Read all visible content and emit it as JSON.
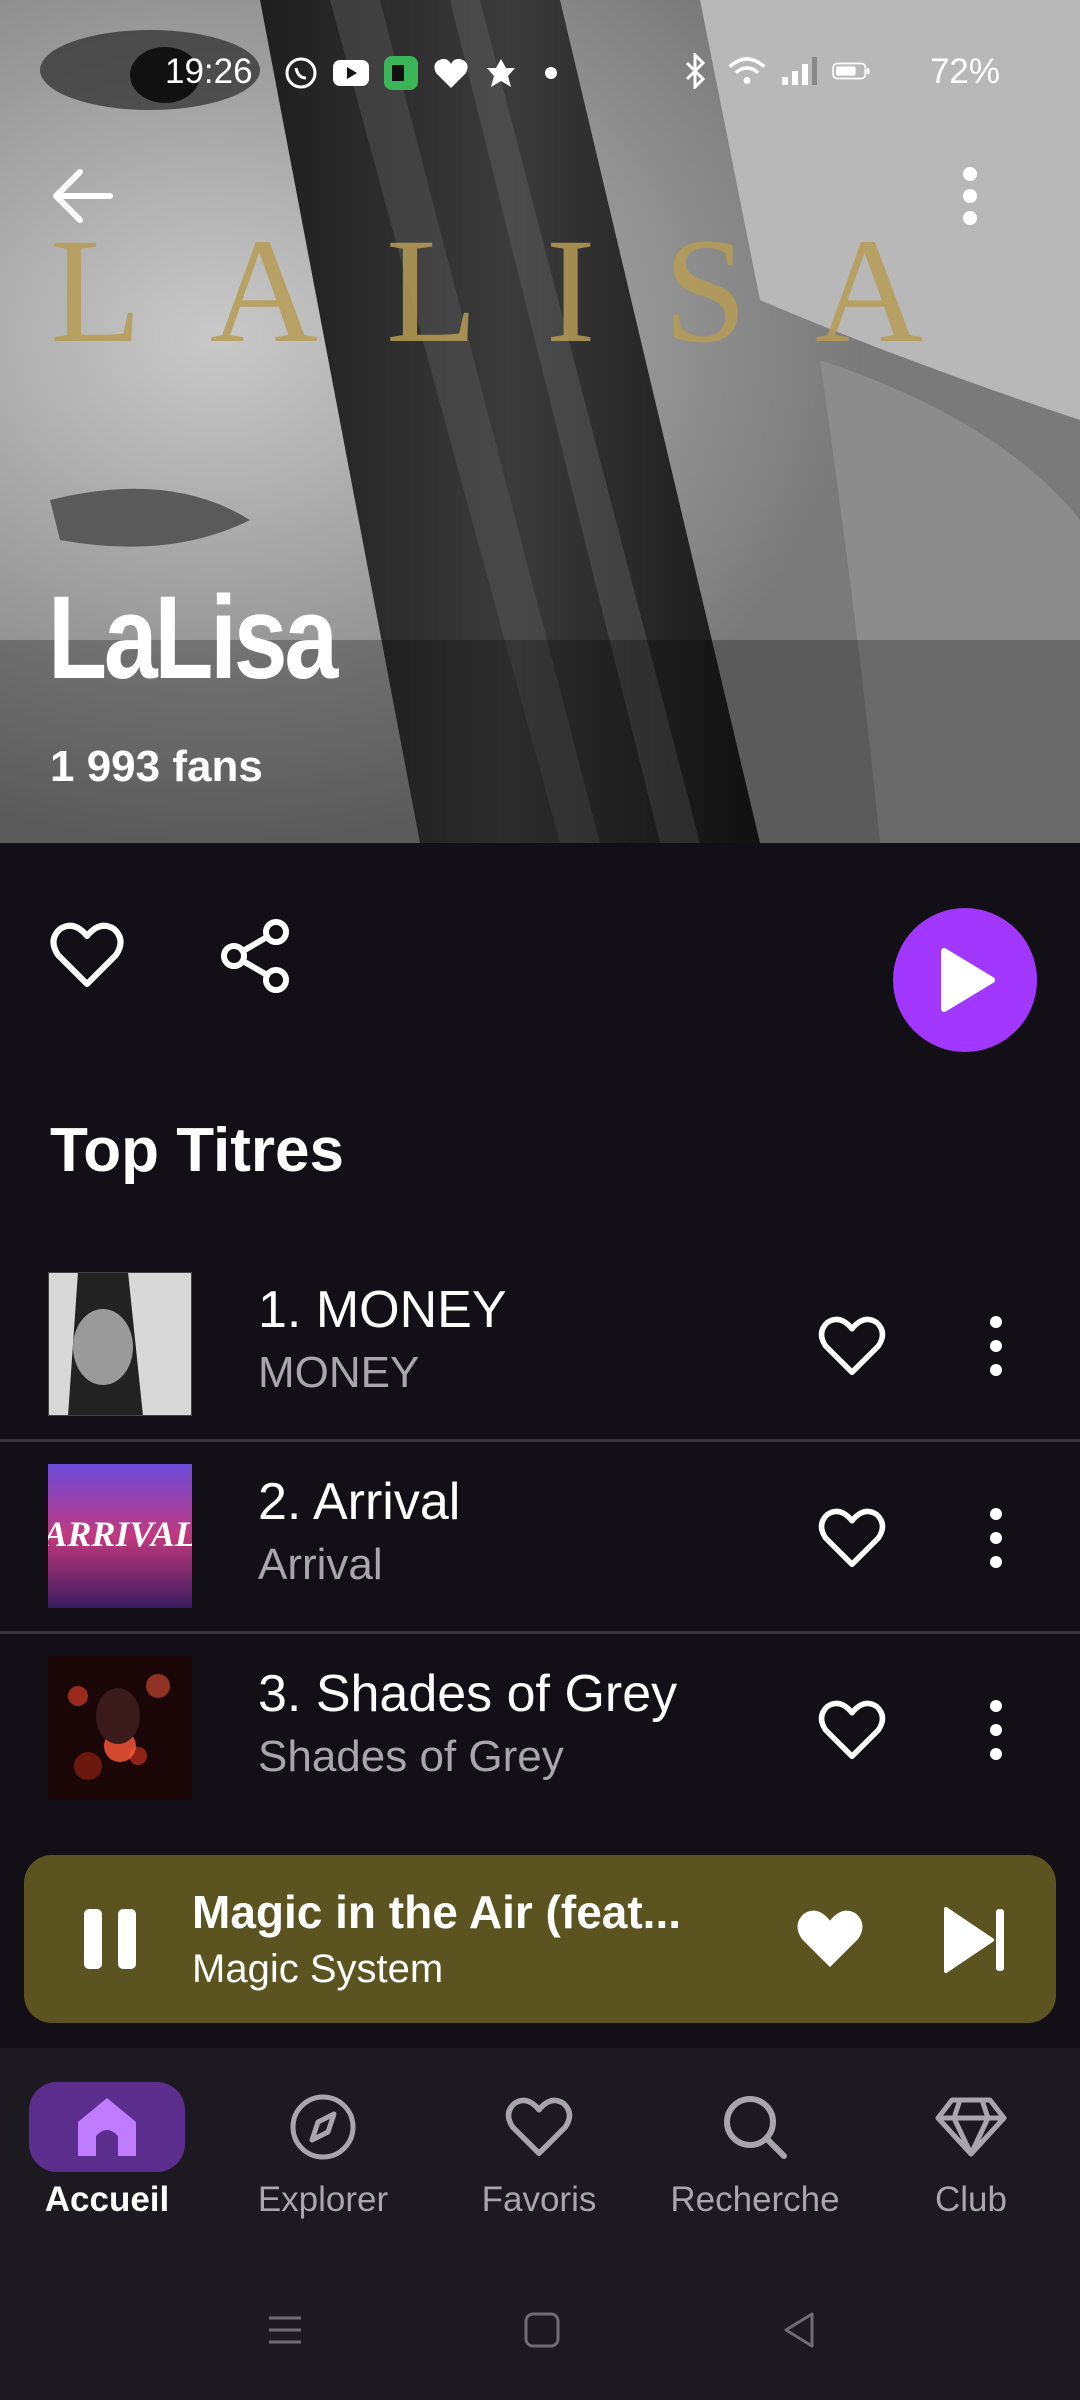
{
  "status_bar": {
    "time": "19:26",
    "battery": "72%",
    "icons_left": [
      "whatsapp-icon",
      "youtube-icon",
      "app-icon",
      "heart-app-icon",
      "leaf-app-icon",
      "dot-icon"
    ],
    "icons_right": [
      "bluetooth-icon",
      "wifi-icon",
      "signal-icon",
      "battery-icon"
    ]
  },
  "header": {
    "wordmark": "LALISA",
    "artist_name": "LaLisa",
    "fans": "1 993 fans"
  },
  "section": {
    "title": "Top Titres"
  },
  "tracks": [
    {
      "title": "1. MONEY",
      "subtitle": "MONEY"
    },
    {
      "title": "2. Arrival",
      "subtitle": "Arrival"
    },
    {
      "title": "3. Shades of Grey",
      "subtitle": "Shades of Grey"
    }
  ],
  "mini_player": {
    "title": "Magic in the Air (feat...",
    "artist": "Magic System",
    "bg_color": "#5b5420"
  },
  "bottom_nav": [
    {
      "label": "Accueil",
      "icon": "home-icon",
      "active": true
    },
    {
      "label": "Explorer",
      "icon": "compass-icon",
      "active": false
    },
    {
      "label": "Favoris",
      "icon": "heart-icon",
      "active": false
    },
    {
      "label": "Recherche",
      "icon": "search-icon",
      "active": false
    },
    {
      "label": "Club",
      "icon": "diamond-icon",
      "active": false
    }
  ],
  "colors": {
    "accent": "#a238ff",
    "background": "#121016",
    "nav_active": "#5b2d8c"
  }
}
